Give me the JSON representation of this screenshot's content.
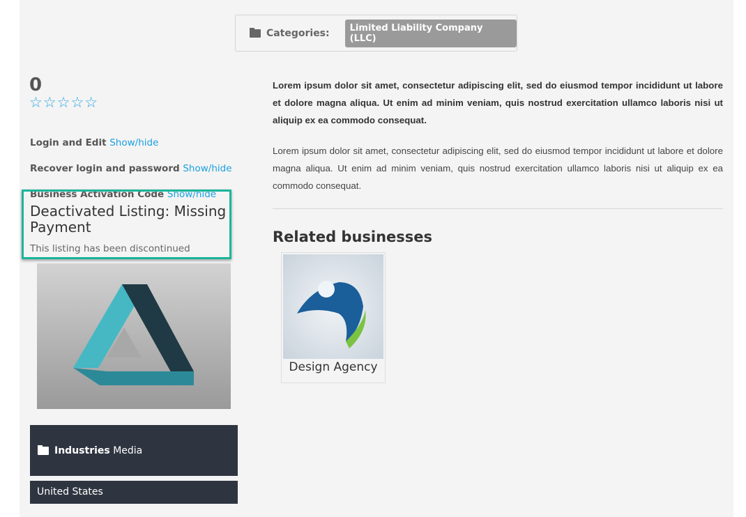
{
  "categories": {
    "label": "Categories:",
    "value": "Limited Liability Company (LLC)"
  },
  "rating": {
    "score": "0",
    "stars": "☆☆☆☆☆",
    "filled": 0,
    "max": 5
  },
  "links": [
    {
      "label": "Login and Edit",
      "action": "Show/hide"
    },
    {
      "label": "Recover login and password",
      "action": "Show/hide"
    },
    {
      "label": "Business Activation Code",
      "action": "Show/hide"
    }
  ],
  "status": {
    "title": "Deactivated Listing: Missing Payment",
    "message": "This listing has been discontinued"
  },
  "industries": {
    "label": "Industries",
    "value": "Media"
  },
  "country": "United States",
  "description": {
    "intro": "Lorem ipsum dolor sit amet, consectetur adipiscing elit, sed do eiusmod tempor incididunt ut labore et dolore magna aliqua. Ut enim ad minim veniam, quis nostrud exercitation ullamco laboris nisi ut aliquip ex ea commodo consequat.",
    "body": "Lorem ipsum dolor sit amet, consectetur adipiscing elit, sed do eiusmod tempor incididunt ut labore et dolore magna aliqua. Ut enim ad minim veniam, quis nostrud exercitation ullamco laboris nisi ut aliquip ex ea commodo consequat."
  },
  "related": {
    "heading": "Related businesses",
    "items": [
      {
        "name": "Design Agency"
      }
    ]
  },
  "colors": {
    "link": "#1a9fe0",
    "highlight": "#1ab59a",
    "dark_panel": "#2f3540"
  }
}
